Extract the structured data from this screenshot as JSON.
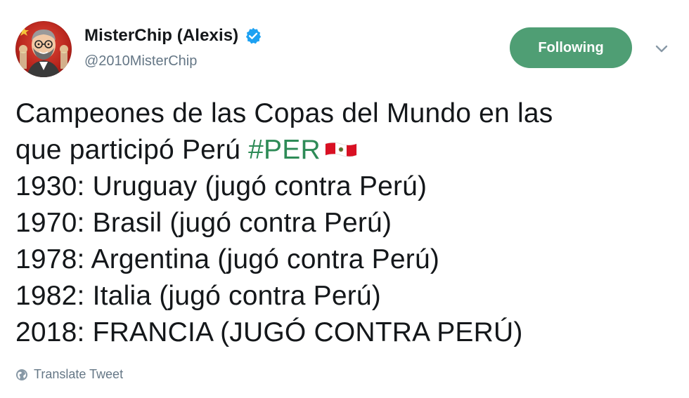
{
  "tweet": {
    "author": {
      "display_name": "MisterChip (Alexis)",
      "handle": "@2010MisterChip",
      "verified": true,
      "avatar_icon": "avatar-caricature"
    },
    "follow_button": {
      "label": "Following",
      "color": "#4f9e74"
    },
    "menu_icon": "chevron-down-icon",
    "text": {
      "line1": "Campeones de las Copas del Mundo en las",
      "line2_prefix": "que participó Perú ",
      "hashtag": "#PER",
      "hashtag_color": "#2e8b57",
      "flag_icon": "peru-flag-icon",
      "lines": [
        "1930: Uruguay (jugó contra Perú)",
        "1970: Brasil (jugó contra Perú)",
        "1978: Argentina (jugó contra Perú)",
        "1982: Italia (jugó contra Perú)",
        "2018: FRANCIA (JUGÓ CONTRA PERÚ)"
      ]
    },
    "translate_label": "Translate Tweet",
    "translate_icon": "globe-icon"
  }
}
